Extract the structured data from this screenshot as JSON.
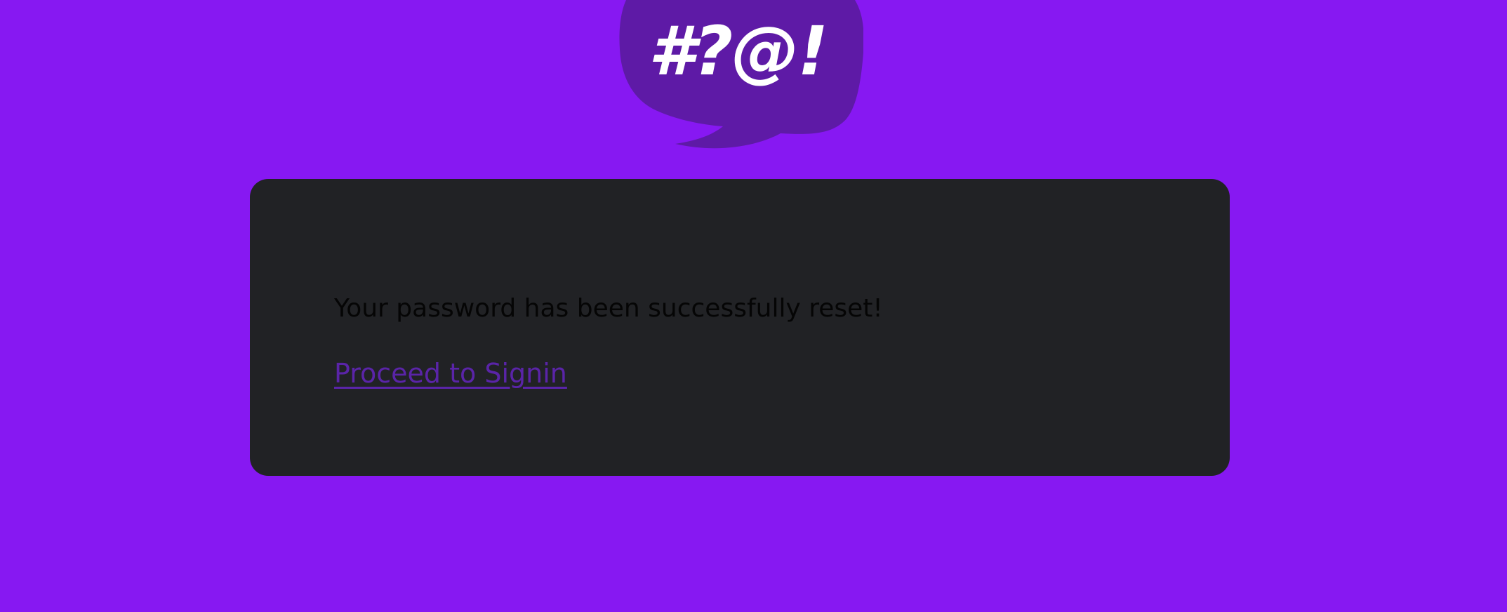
{
  "logo": {
    "text": "#?@!",
    "icon": "speech-bubble-icon",
    "bubble_color": "#5e1aa6",
    "text_color": "#ffffff"
  },
  "colors": {
    "background": "#8718f2",
    "card": "#212225",
    "message": "#050505",
    "link": "#5a24a8"
  },
  "card": {
    "message": "Your password has been successfully reset!",
    "link_label": "Proceed to Signin"
  }
}
